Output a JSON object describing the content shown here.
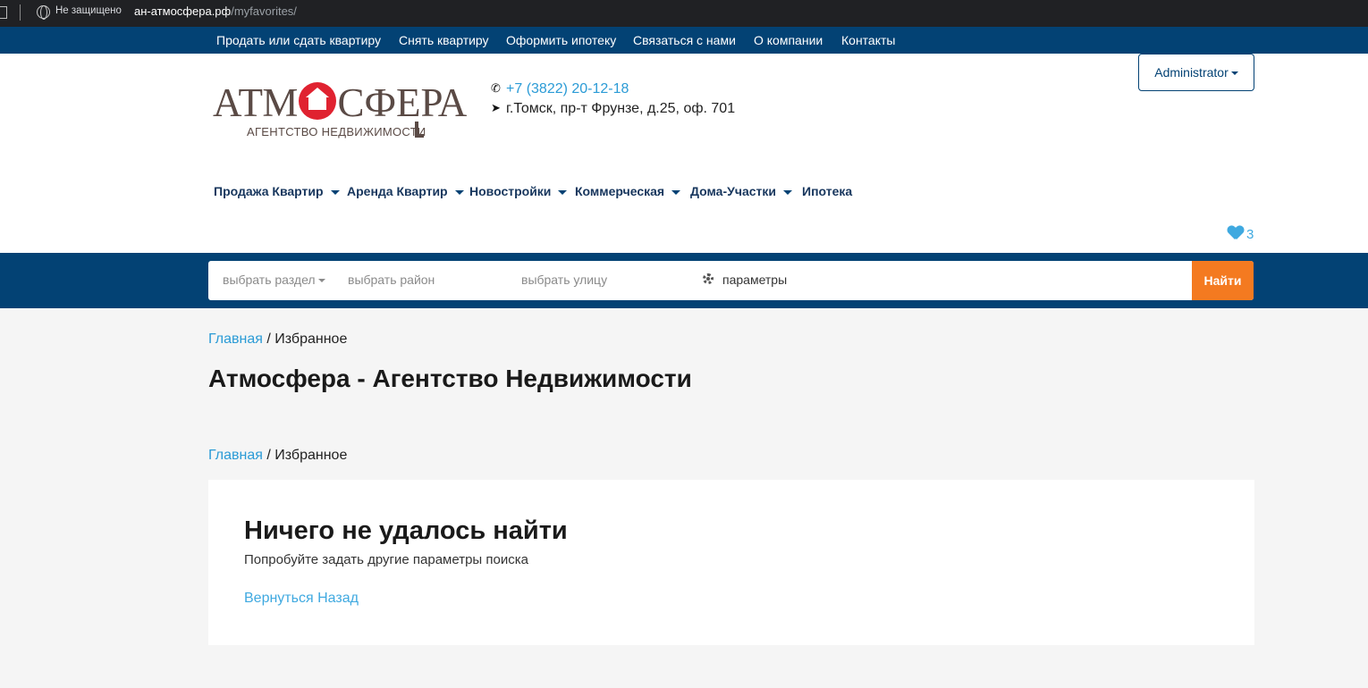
{
  "browser": {
    "security_label": "Не защищено",
    "url_host": "ан-атмосфера.рф",
    "url_path": "/myfavorites/"
  },
  "top_nav": {
    "items": [
      "Продать или сдать квартиру",
      "Снять квартиру",
      "Оформить ипотеку",
      "Связаться с нами",
      "О компании",
      "Контакты"
    ]
  },
  "header": {
    "logo_main": "АТМ",
    "logo_main_end": "СФЕРА",
    "logo_sub": "АГЕНТСТВО НЕДВИЖИМОСТИ",
    "phone": "+7 (3822) 20-12-18",
    "address": "г.Томск, пр-т Фрунзе, д.25, оф. 701",
    "user_label": "Administrator",
    "favorites_count": "3"
  },
  "main_menu": {
    "items": [
      "Продажа Квартир",
      "Аренда Квартир",
      "Новостройки",
      "Коммерческая",
      "Дома-Участки",
      "Ипотека"
    ]
  },
  "search": {
    "section_placeholder": "выбрать раздел",
    "district_placeholder": "выбрать район",
    "street_placeholder": "выбрать улицу",
    "params_label": "параметры",
    "submit_label": "Найти"
  },
  "breadcrumb": {
    "home": "Главная",
    "separator": " / ",
    "current": "Избранное"
  },
  "page": {
    "title": "Атмосфера - Агентство Недвижимости"
  },
  "empty_state": {
    "heading": "Ничего не удалось найти",
    "text": "Попробуйте задать другие параметры поиска",
    "back_link": "Вернуться Назад"
  },
  "colors": {
    "brand_blue": "#034274",
    "accent_orange": "#f47a20",
    "link_blue": "#2b9bd6",
    "logo_red": "#e02230"
  }
}
